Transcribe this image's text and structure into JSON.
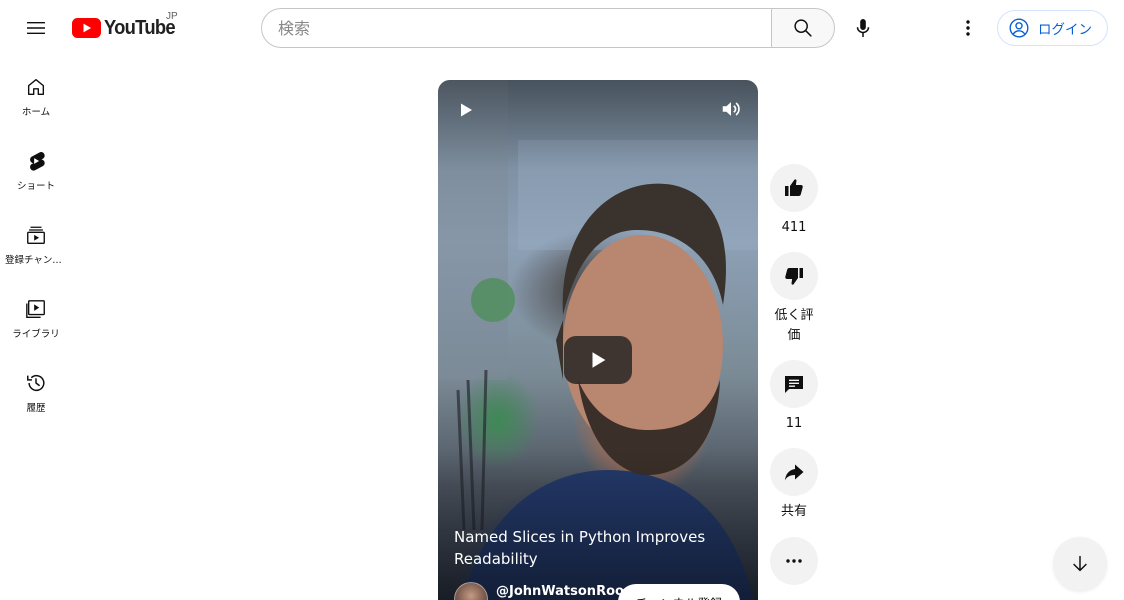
{
  "header": {
    "logo_text": "YouTube",
    "region": "JP",
    "search_placeholder": "検索",
    "search_value": "",
    "login_label": "ログイン"
  },
  "sidebar": {
    "items": [
      {
        "label": "ホーム",
        "icon": "home-icon"
      },
      {
        "label": "ショート",
        "icon": "shorts-icon"
      },
      {
        "label": "登録チャンネル",
        "icon": "subscriptions-icon"
      },
      {
        "label": "ライブラリ",
        "icon": "library-icon"
      },
      {
        "label": "履歴",
        "icon": "history-icon"
      }
    ]
  },
  "video": {
    "title": "Named Slices in Python Improves Readability",
    "channel": "@JohnWatsonRoo",
    "subscribe_label": "チャンネル登録"
  },
  "actions": {
    "like_count": "411",
    "dislike_label": "低く評価",
    "comment_count": "11",
    "share_label": "共有"
  },
  "colors": {
    "brand_red": "#ff0000",
    "link_blue": "#065fd4",
    "action_bg": "#f2f2f2"
  }
}
